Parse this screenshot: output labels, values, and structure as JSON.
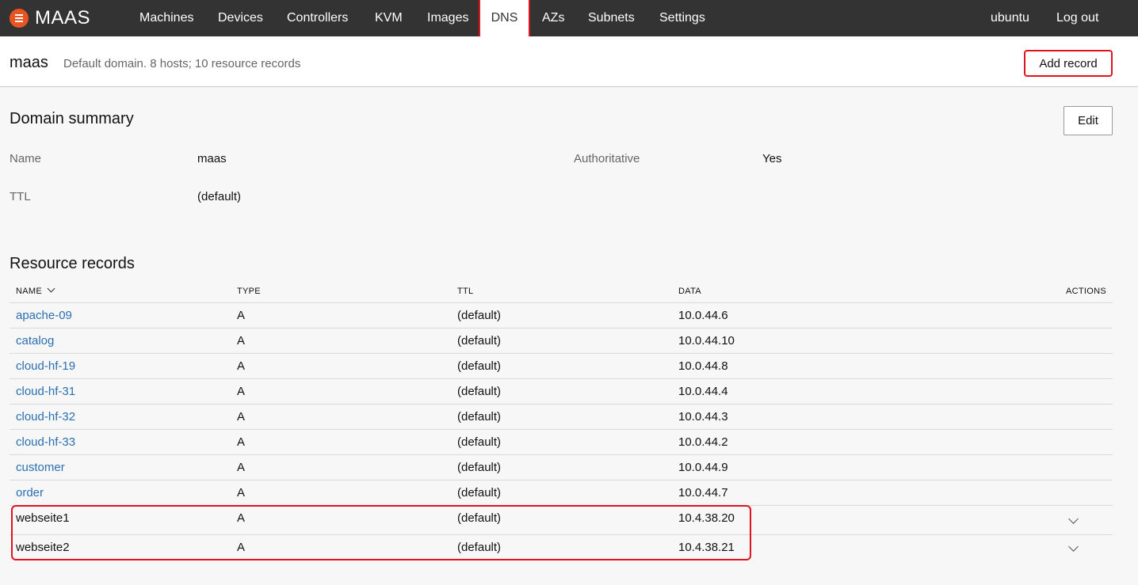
{
  "nav": {
    "brand": "MAAS",
    "items": [
      {
        "label": "Machines",
        "active": false
      },
      {
        "label": "Devices",
        "active": false
      },
      {
        "label": "Controllers",
        "active": false
      },
      {
        "label": "KVM",
        "active": false
      },
      {
        "label": "Images",
        "active": false
      },
      {
        "label": "DNS",
        "active": true
      },
      {
        "label": "AZs",
        "active": false
      },
      {
        "label": "Subnets",
        "active": false
      },
      {
        "label": "Settings",
        "active": false
      }
    ],
    "user": "ubuntu",
    "logout": "Log out"
  },
  "header": {
    "title": "maas",
    "subtitle": "Default domain. 8 hosts; 10 resource records",
    "add_record": "Add record"
  },
  "summary": {
    "title": "Domain summary",
    "edit": "Edit",
    "name_label": "Name",
    "name_value": "maas",
    "authoritative_label": "Authoritative",
    "authoritative_value": "Yes",
    "ttl_label": "TTL",
    "ttl_value": "(default)"
  },
  "records": {
    "title": "Resource records",
    "columns": {
      "name": "NAME",
      "type": "TYPE",
      "ttl": "TTL",
      "data": "DATA",
      "actions": "ACTIONS"
    },
    "rows": [
      {
        "name": "apache-09",
        "type": "A",
        "ttl": "(default)",
        "data": "10.0.44.6",
        "link": true,
        "expandable": false
      },
      {
        "name": "catalog",
        "type": "A",
        "ttl": "(default)",
        "data": "10.0.44.10",
        "link": true,
        "expandable": false
      },
      {
        "name": "cloud-hf-19",
        "type": "A",
        "ttl": "(default)",
        "data": "10.0.44.8",
        "link": true,
        "expandable": false
      },
      {
        "name": "cloud-hf-31",
        "type": "A",
        "ttl": "(default)",
        "data": "10.0.44.4",
        "link": true,
        "expandable": false
      },
      {
        "name": "cloud-hf-32",
        "type": "A",
        "ttl": "(default)",
        "data": "10.0.44.3",
        "link": true,
        "expandable": false
      },
      {
        "name": "cloud-hf-33",
        "type": "A",
        "ttl": "(default)",
        "data": "10.0.44.2",
        "link": true,
        "expandable": false
      },
      {
        "name": "customer",
        "type": "A",
        "ttl": "(default)",
        "data": "10.0.44.9",
        "link": true,
        "expandable": false
      },
      {
        "name": "order",
        "type": "A",
        "ttl": "(default)",
        "data": "10.0.44.7",
        "link": true,
        "expandable": false
      },
      {
        "name": "webseite1",
        "type": "A",
        "ttl": "(default)",
        "data": "10.4.38.20",
        "link": false,
        "expandable": true
      },
      {
        "name": "webseite2",
        "type": "A",
        "ttl": "(default)",
        "data": "10.4.38.21",
        "link": false,
        "expandable": true
      }
    ]
  },
  "colors": {
    "nav_bg": "#333333",
    "brand": "#e95420",
    "link": "#2b6fb1",
    "highlight": "#e0141e"
  }
}
